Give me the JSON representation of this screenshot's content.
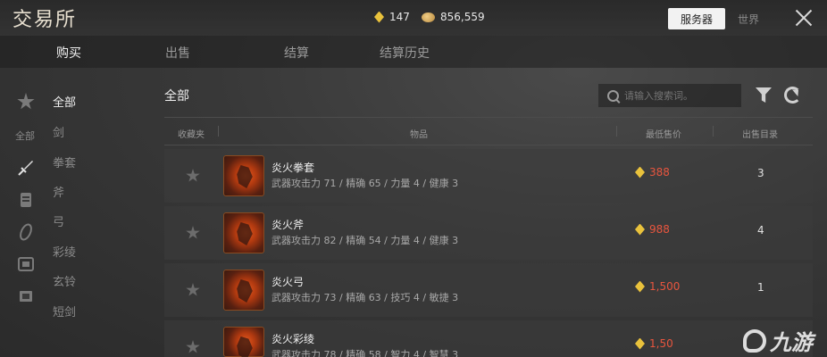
{
  "header": {
    "title": "交易所",
    "gold_amount": "147",
    "coin_amount": "856,559",
    "server_active": "服务器",
    "server_inactive": "世界"
  },
  "tabs": [
    {
      "label": "购买"
    },
    {
      "label": "出售"
    },
    {
      "label": "结算"
    },
    {
      "label": "结算历史"
    }
  ],
  "sidebar": {
    "favorites_label": "全部",
    "categories": [
      {
        "label": "全部"
      },
      {
        "label": "剑"
      },
      {
        "label": "拳套"
      },
      {
        "label": "斧"
      },
      {
        "label": "弓"
      },
      {
        "label": "彩绫"
      },
      {
        "label": "玄铃"
      },
      {
        "label": "短剑"
      }
    ]
  },
  "main": {
    "heading": "全部",
    "search_placeholder": "请输入搜索词。",
    "columns": [
      "收藏夹",
      "物品",
      "最低售价",
      "出售目录"
    ]
  },
  "items": [
    {
      "name": "炎火拳套",
      "stats": "武器攻击力 71  / 精确 65  / 力量 4  / 健康 3",
      "price": "388",
      "count": "3"
    },
    {
      "name": "炎火斧",
      "stats": "武器攻击力 82  / 精确 54  / 力量 4  / 健康 3",
      "price": "988",
      "count": "4"
    },
    {
      "name": "炎火弓",
      "stats": "武器攻击力 73  / 精确 63  / 技巧 4  / 敏捷 3",
      "price": "1,500",
      "count": "1"
    },
    {
      "name": "炎火彩绫",
      "stats": "武器攻击力 78  / 精确 58  / 智力 4  / 智慧 3",
      "price": "1,50",
      "count": ""
    }
  ],
  "watermark": "九游",
  "colors": {
    "price_red": "#e8553e",
    "gold_gem": "#e9c23c",
    "tab_active": "#f0f0f0"
  }
}
